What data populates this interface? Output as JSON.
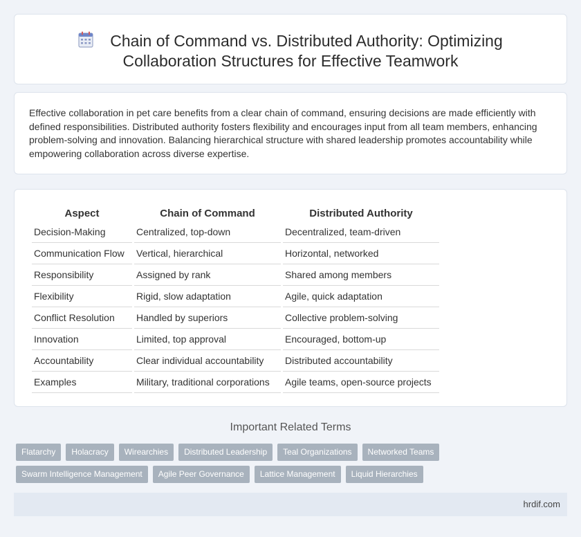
{
  "header": {
    "title_line1": "Chain of Command vs. Distributed Authority: Optimizing",
    "title_line2": "Collaboration Structures for Effective Teamwork"
  },
  "intro": {
    "text": "Effective collaboration in pet care benefits from a clear chain of command, ensuring decisions are made efficiently with defined responsibilities. Distributed authority fosters flexibility and encourages input from all team members, enhancing problem-solving and innovation. Balancing hierarchical structure with shared leadership promotes accountability while empowering collaboration across diverse expertise."
  },
  "table": {
    "headers": [
      "Aspect",
      "Chain of Command",
      "Distributed Authority"
    ],
    "rows": [
      [
        "Decision-Making",
        "Centralized, top-down",
        "Decentralized, team-driven"
      ],
      [
        "Communication Flow",
        "Vertical, hierarchical",
        "Horizontal, networked"
      ],
      [
        "Responsibility",
        "Assigned by rank",
        "Shared among members"
      ],
      [
        "Flexibility",
        "Rigid, slow adaptation",
        "Agile, quick adaptation"
      ],
      [
        "Conflict Resolution",
        "Handled by superiors",
        "Collective problem-solving"
      ],
      [
        "Innovation",
        "Limited, top approval",
        "Encouraged, bottom-up"
      ],
      [
        "Accountability",
        "Clear individual accountability",
        "Distributed accountability"
      ],
      [
        "Examples",
        "Military, traditional corporations",
        "Agile teams, open-source projects"
      ]
    ]
  },
  "related": {
    "title": "Important Related Terms",
    "row1": [
      "Flatarchy",
      "Holacracy",
      "Wirearchies",
      "Distributed Leadership",
      "Teal Organizations",
      "Networked Teams"
    ],
    "row2": [
      "Swarm Intelligence Management",
      "Agile Peer Governance",
      "Lattice Management",
      "Liquid Hierarchies"
    ]
  },
  "footer": {
    "site": "hrdif.com"
  },
  "colors": {
    "tag_bg": "#a8b2bd",
    "page_bg": "#f0f3f8",
    "footer_bg": "#e3e9f2"
  },
  "icons": {
    "title_icon": "calendar-icon"
  }
}
